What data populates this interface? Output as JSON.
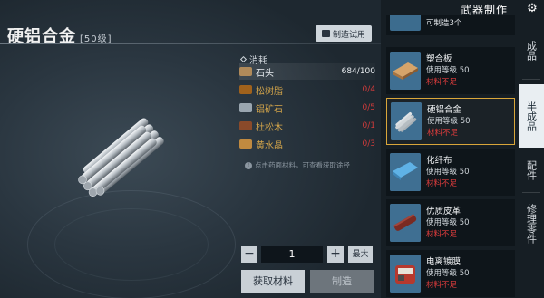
{
  "item": {
    "name": "硬铝合金",
    "tier": "[50级]",
    "trial_label": "制造试用"
  },
  "materials": {
    "header": "消耗",
    "rows": [
      {
        "name": "石头",
        "count": "684/100",
        "status": "ok",
        "icon": "stone-icon",
        "color": "#b08a5a"
      },
      {
        "name": "松树脂",
        "count": "0/4",
        "status": "lack",
        "icon": "resin-icon",
        "color": "#a0621c"
      },
      {
        "name": "铝矿石",
        "count": "0/5",
        "status": "lack",
        "icon": "aluminum-ore-icon",
        "color": "#9aa6b0"
      },
      {
        "name": "杜松木",
        "count": "0/1",
        "status": "lack",
        "icon": "juniper-wood-icon",
        "color": "#8a4a2a"
      },
      {
        "name": "黄水晶",
        "count": "0/3",
        "status": "lack",
        "icon": "citrine-icon",
        "color": "#c08a40"
      }
    ],
    "hint": "点击药面材料，可查看获取途径"
  },
  "quantity": {
    "value": "1",
    "minus": "−",
    "plus": "+",
    "max_label": "最大"
  },
  "actions": {
    "get_materials": "获取材料",
    "craft": "制造"
  },
  "panel": {
    "title": "武器制作",
    "partial_top_text": "可制造3个",
    "cards": [
      {
        "name": "塑合板",
        "level": "使用等级  50",
        "status": "材料不足",
        "selected": false,
        "thumb": "plywood"
      },
      {
        "name": "硬铝合金",
        "level": "使用等级  50",
        "status": "材料不足",
        "selected": true,
        "thumb": "alloy"
      },
      {
        "name": "化纤布",
        "level": "使用等级  50",
        "status": "材料不足",
        "selected": false,
        "thumb": "fabric"
      },
      {
        "name": "优质皮革",
        "level": "使用等级  50",
        "status": "材料不足",
        "selected": false,
        "thumb": "leather"
      },
      {
        "name": "电离镀膜",
        "level": "使用等级  50",
        "status": "材料不足",
        "selected": false,
        "thumb": "coating"
      }
    ]
  },
  "tabs": [
    {
      "label": "成品",
      "active": false
    },
    {
      "label": "半成品",
      "active": true
    },
    {
      "label": "配件",
      "active": false
    },
    {
      "label": "修理零件",
      "active": false
    }
  ]
}
